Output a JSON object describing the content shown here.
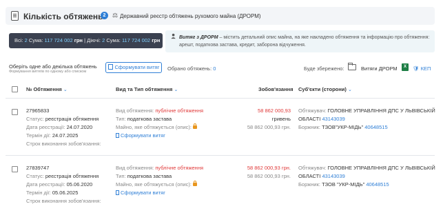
{
  "header": {
    "title": "Кількість обтяжень:",
    "count": "2",
    "registry": "Державний реєстр обтяжень рухомого майна (ДРОРМ)"
  },
  "totals": {
    "all_label": "Всі:",
    "all_count": "2",
    "sum_label": "Сума:",
    "all_sum": "117 724 002",
    "currency": "грн",
    "separator": "|",
    "active_label": "Діючі:",
    "active_count": "2",
    "active_sum": "117 724 002"
  },
  "info": {
    "title": "Витяг з ДРОРМ",
    "text": " – містить детальний опис майна, на яке накладено обтяження та інформацію про обтяження: арешт, податкова застава, кредит, заборона відчуження."
  },
  "toolbar": {
    "select_label": "Оберіть одне або декілька обтяжень",
    "select_sub": "Формування витягів по одному або списком",
    "form_button": "Сформувати витяг",
    "selected_label": "Обрано обтяжень:",
    "selected_count": "0",
    "save_label": "Буде збережено:",
    "folder_label": "Витяги ДРОРМ",
    "excel_icon_text": "X",
    "kep_label": "КЕП"
  },
  "table": {
    "columns": {
      "number": "№ Обтяження",
      "type": "Вид та Тип обтяження",
      "obligation": "Зобов'язання",
      "subjects": "Суб'єкти (сторони)"
    },
    "rows": [
      {
        "number": "27965833",
        "status_label": "Статус:",
        "status": "реєстрація обтяження",
        "reg_date_label": "Дата реєстрації:",
        "reg_date": "24.07.2020",
        "term_label": "Термін дії:",
        "term": "24.07.2025",
        "deadline_label": "Строк виконання зобов'язання:",
        "kind_label": "Вид обтяження:",
        "kind": "публічне обтяження",
        "type_label": "Тип:",
        "type": "податкова застава",
        "property_label": "Майно, яке обтяжується (опис):",
        "form_link": "Сформувати витяг",
        "amount": "58 862 000,93",
        "amount_currency": "гривень",
        "amount_equiv": "58 862 000,93 грн.",
        "creditor_label": "Обтяжувач:",
        "creditor": "ГОЛОВНЕ УПРАВЛІННЯ ДПС У ЛЬВІВСЬКІЙ",
        "creditor_cont": "ОБЛАСТІ",
        "creditor_code": "43143039",
        "debtor_label": "Боржник:",
        "debtor": "ТЗОВ\"УКР-МІДЬ\"",
        "debtor_code": "40648515"
      },
      {
        "number": "27839747",
        "status_label": "Статус:",
        "status": "реєстрація обтяження",
        "reg_date_label": "Дата реєстрації:",
        "reg_date": "05.06.2020",
        "term_label": "Термін дії:",
        "term": "05.06.2025",
        "deadline_label": "Строк виконання зобов'язання:",
        "kind_label": "Вид обтяження:",
        "kind": "публічне обтяження",
        "type_label": "Тип:",
        "type": "податкова застава",
        "property_label": "Майно, яке обтяжується (опис):",
        "form_link": "Сформувати витяг",
        "amount": "58 862 000,93 грн.",
        "amount_equiv": "58 862 000,93 грн.",
        "creditor_label": "Обтяжувач:",
        "creditor": "ГОЛОВНЕ УПРАВЛІННЯ ДПС У ЛЬВІВСЬКІЙ",
        "creditor_cont": "ОБЛАСТІ",
        "creditor_code": "43143039",
        "debtor_label": "Боржник:",
        "debtor": "ТЗОВ \"УКР-МІДЬ\"",
        "debtor_code": "40648515"
      }
    ]
  }
}
